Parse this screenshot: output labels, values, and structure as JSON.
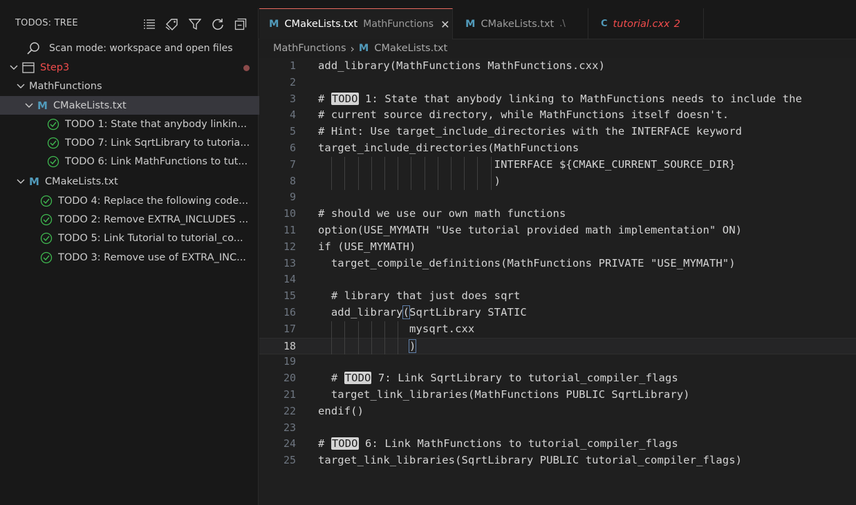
{
  "sidebar": {
    "title": "TODOS: TREE",
    "scan_mode": "Scan mode: workspace and open files",
    "workspace": "Step3",
    "folder": "MathFunctions",
    "file1": "CMakeLists.txt",
    "file1_todos": [
      "TODO 1: State that anybody linkin...",
      "TODO 7: Link SqrtLibrary to tutoria...",
      "TODO 6: Link MathFunctions to tut..."
    ],
    "file2": "CMakeLists.txt",
    "file2_todos": [
      "TODO 4: Replace the following code...",
      "TODO 2: Remove EXTRA_INCLUDES ...",
      "TODO 5: Link Tutorial to tutorial_co...",
      "TODO 3: Remove use of EXTRA_INC..."
    ],
    "icons": [
      "list-icon",
      "tag-icon",
      "filter-icon",
      "refresh-icon",
      "collapse-all-icon"
    ]
  },
  "tabs": [
    {
      "icon": "M",
      "label": "CMakeLists.txt",
      "desc": "MathFunctions",
      "close": "✕"
    },
    {
      "icon": "M",
      "label": "CMakeLists.txt",
      "desc": ".\\"
    },
    {
      "icon": "C",
      "label": "tutorial.cxx",
      "badge": "2"
    }
  ],
  "breadcrumb": {
    "folder": "MathFunctions",
    "separator": "›",
    "icon": "M",
    "file": "CMakeLists.txt"
  },
  "editor": {
    "current_line": 18,
    "lines": [
      "add_library(MathFunctions MathFunctions.cxx)",
      "",
      "# TODO 1: State that anybody linking to MathFunctions needs to include the",
      "# current source directory, while MathFunctions itself doesn't.",
      "# Hint: Use target_include_directories with the INTERFACE keyword",
      "target_include_directories(MathFunctions",
      "                           INTERFACE ${CMAKE_CURRENT_SOURCE_DIR}",
      "                           )",
      "",
      "# should we use our own math functions",
      "option(USE_MYMATH \"Use tutorial provided math implementation\" ON)",
      "if (USE_MYMATH)",
      "  target_compile_definitions(MathFunctions PRIVATE \"USE_MYMATH\")",
      "",
      "  # library that just does sqrt",
      "  add_library(SqrtLibrary STATIC",
      "              mysqrt.cxx",
      "              )",
      "",
      "  # TODO 7: Link SqrtLibrary to tutorial_compiler_flags",
      "  target_link_libraries(MathFunctions PUBLIC SqrtLibrary)",
      "endif()",
      "",
      "# TODO 6: Link MathFunctions to tutorial_compiler_flags",
      "target_link_libraries(SqrtLibrary PUBLIC tutorial_compiler_flags)"
    ]
  },
  "colors": {
    "workspace_name": "#f14c4c",
    "todo_check": "#3fb950",
    "cmake_icon": "#519aba",
    "active_tab_border": "#e8695f",
    "tutorial_tab": "#f14c4c"
  }
}
